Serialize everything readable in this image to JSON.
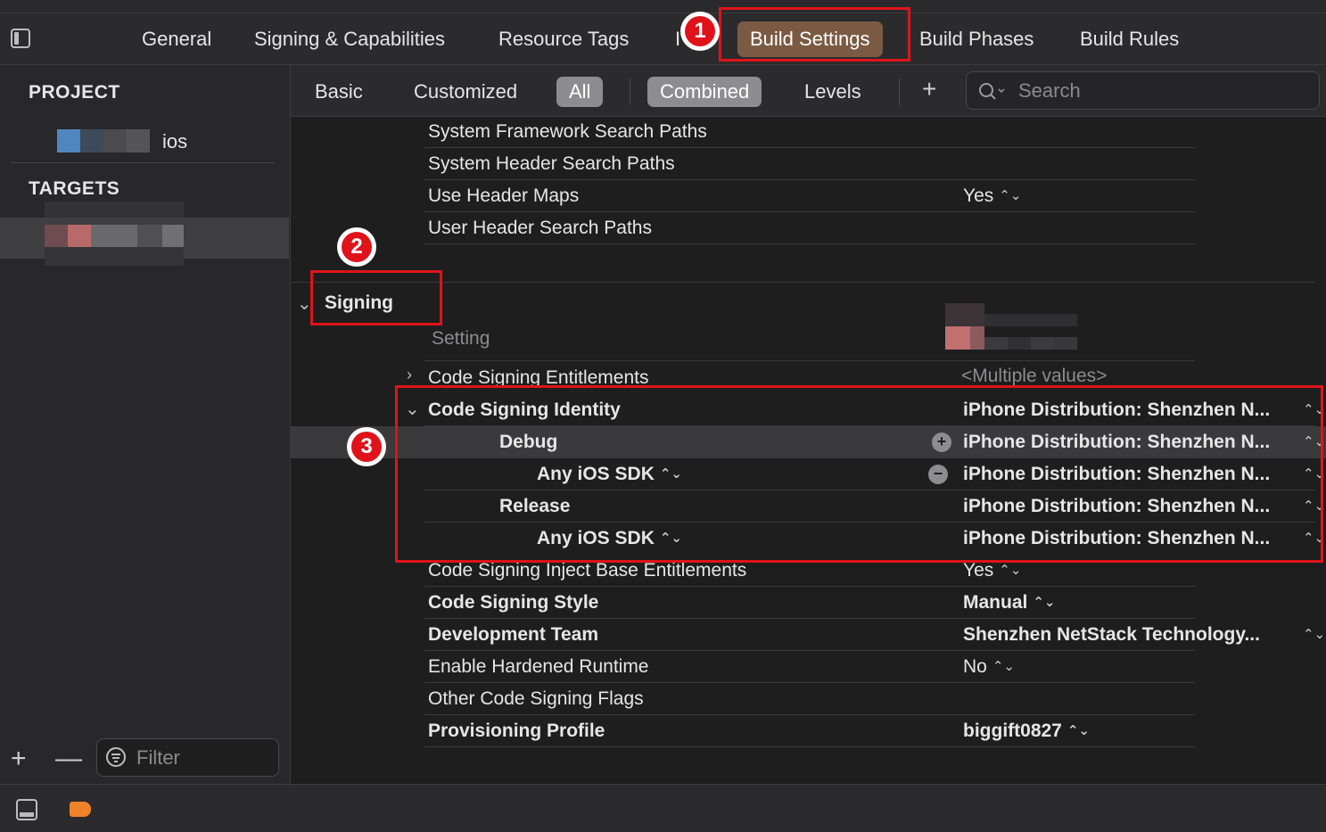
{
  "tabs": {
    "general": "General",
    "signing_capabilities": "Signing & Capabilities",
    "resource_tags": "Resource Tags",
    "info_partial": "I",
    "build_settings": "Build Settings",
    "build_phases": "Build Phases",
    "build_rules": "Build Rules"
  },
  "sidebar": {
    "project_header": "PROJECT",
    "project_item_suffix": "ios",
    "targets_header": "TARGETS",
    "filter_placeholder": "Filter",
    "add_symbol": "+",
    "remove_symbol": "—"
  },
  "filterbar": {
    "basic": "Basic",
    "customized": "Customized",
    "all": "All",
    "combined": "Combined",
    "levels": "Levels",
    "add_symbol": "+",
    "search_placeholder": "Search"
  },
  "settings": {
    "system_framework_search_paths": "System Framework Search Paths",
    "system_header_search_paths": "System Header Search Paths",
    "use_header_maps": "Use Header Maps",
    "use_header_maps_value": "Yes",
    "user_header_search_paths": "User Header Search Paths",
    "signing_section": "Signing",
    "setting_column": "Setting",
    "code_signing_entitlements": "Code Signing Entitlements",
    "code_signing_entitlements_value": "<Multiple values>",
    "code_signing_identity": "Code Signing Identity",
    "code_signing_identity_value": "iPhone Distribution: Shenzhen N...",
    "debug": "Debug",
    "debug_value": "iPhone Distribution: Shenzhen N...",
    "any_ios_sdk_debug": "Any iOS SDK",
    "any_ios_sdk_debug_value": "iPhone Distribution: Shenzhen N...",
    "release": "Release",
    "release_value": "iPhone Distribution: Shenzhen N...",
    "any_ios_sdk_release": "Any iOS SDK",
    "any_ios_sdk_release_value": "iPhone Distribution: Shenzhen N...",
    "inject_base_entitlements": "Code Signing Inject Base Entitlements",
    "inject_base_entitlements_value": "Yes",
    "code_signing_style": "Code Signing Style",
    "code_signing_style_value": "Manual",
    "development_team": "Development Team",
    "development_team_value": "Shenzhen NetStack Technology...",
    "enable_hardened_runtime": "Enable Hardened Runtime",
    "enable_hardened_runtime_value": "No",
    "other_code_signing_flags": "Other Code Signing Flags",
    "provisioning_profile": "Provisioning Profile",
    "provisioning_profile_value": "biggift0827"
  },
  "annotations": {
    "badge_1": "1",
    "badge_2": "2",
    "badge_3": "3"
  },
  "colors": {
    "accent_red": "#e0131a",
    "selected_tab": "#7b5a43",
    "background": "#1e1e1f",
    "tag_orange": "#f0822a"
  }
}
